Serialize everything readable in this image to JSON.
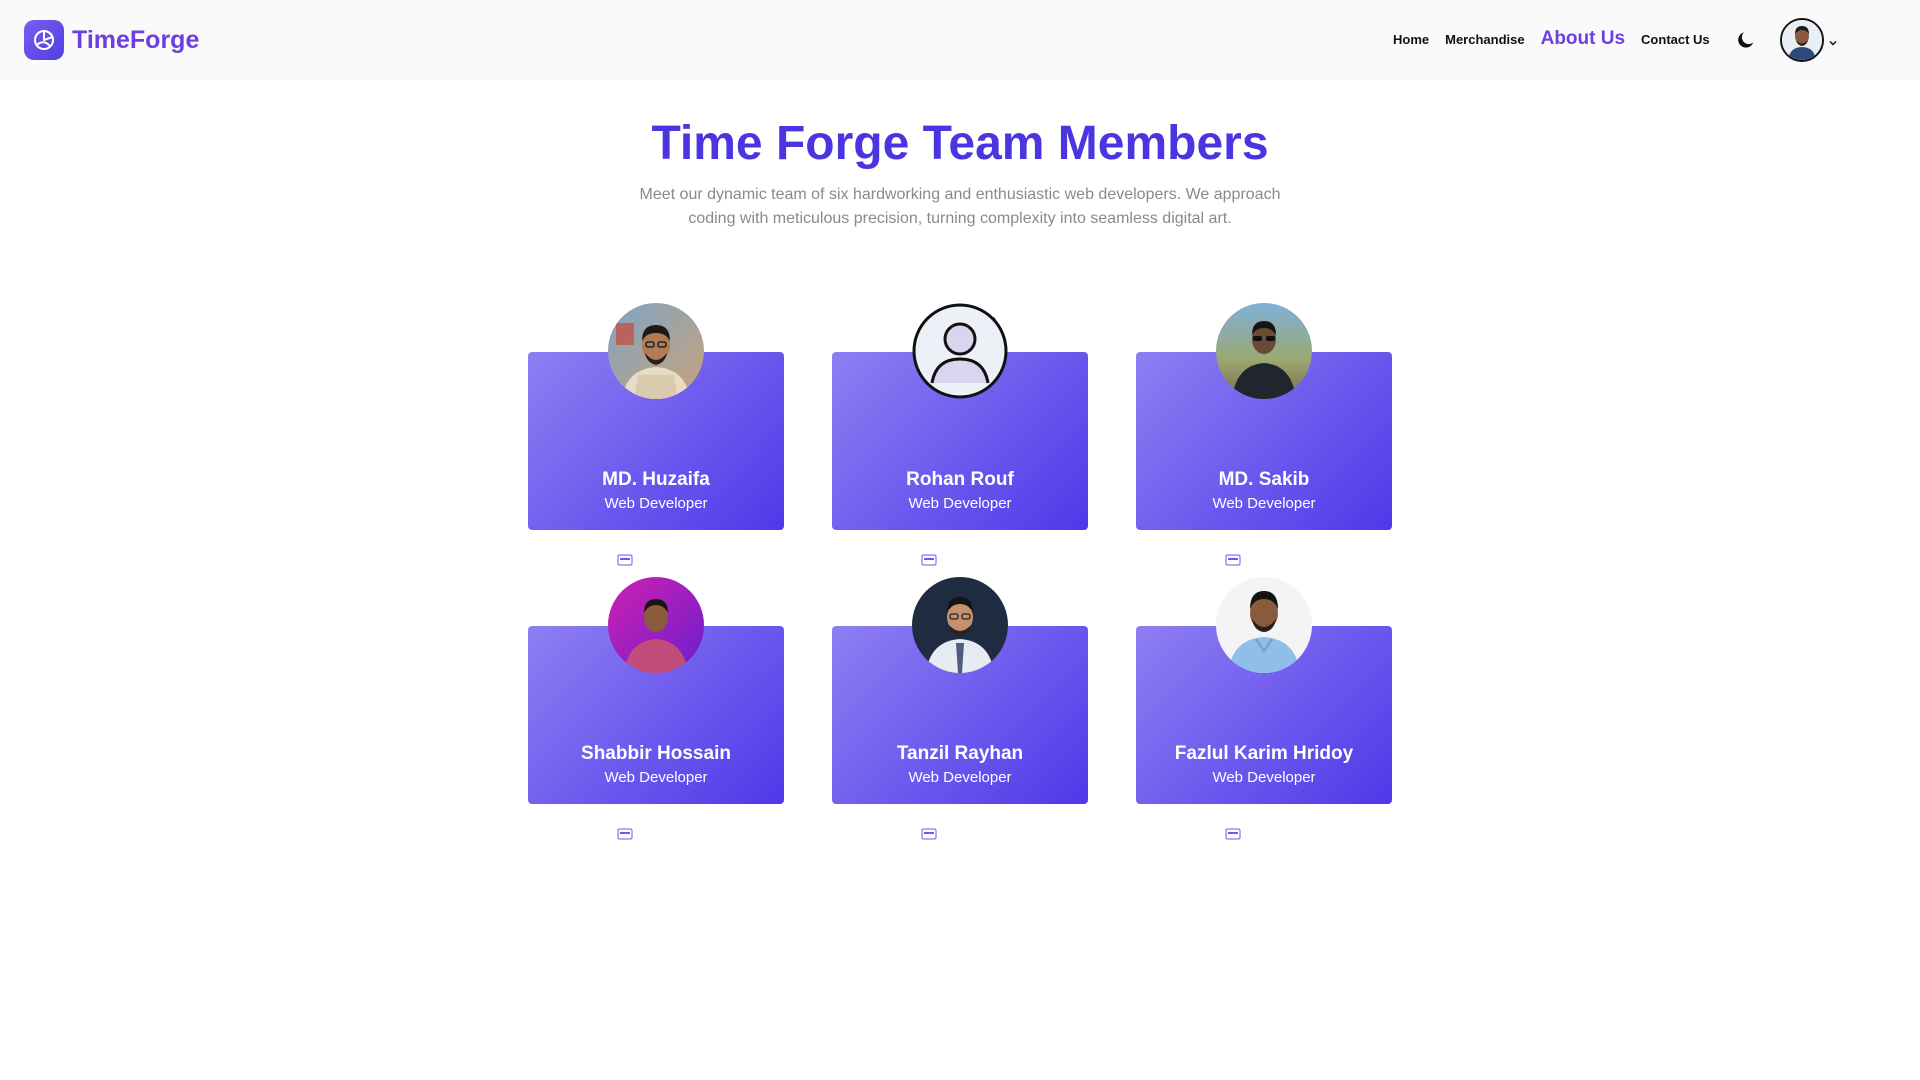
{
  "brand": {
    "name": "TimeForge",
    "color": "#6d3fe0"
  },
  "nav": {
    "links": [
      {
        "label": "Home",
        "active": false
      },
      {
        "label": "Merchandise",
        "active": false
      },
      {
        "label": "About Us",
        "active": true
      },
      {
        "label": "Contact Us",
        "active": false
      }
    ],
    "theme_toggle_icon": "moon-icon",
    "user_menu_icon": "chevron-down-icon"
  },
  "header": {
    "title": "Time Forge Team Members",
    "subtitle": "Meet our dynamic team of six hardworking and enthusiastic web developers. We approach coding with meticulous precision, turning complexity into seamless digital art."
  },
  "team": [
    {
      "name": "MD. Huzaifa",
      "role": "Web Developer",
      "photo": "photo"
    },
    {
      "name": "Rohan Rouf",
      "role": "Web Developer",
      "photo": "placeholder-user-icon"
    },
    {
      "name": "MD. Sakib",
      "role": "Web Developer",
      "photo": "photo"
    },
    {
      "name": "Shabbir Hossain",
      "role": "Web Developer",
      "photo": "photo"
    },
    {
      "name": "Tanzil Rayhan",
      "role": "Web Developer",
      "photo": "photo"
    },
    {
      "name": "Fazlul Karim Hridoy",
      "role": "Web Developer",
      "photo": "photo"
    }
  ],
  "social_icons": [
    "portfolio-icon",
    "linkedin-icon",
    "github-icon"
  ],
  "colors": {
    "title": "#4a35e0",
    "card_gradient_start": "#8f7ff2",
    "card_gradient_end": "#4f38e8",
    "subtitle": "#8a8a8a"
  }
}
